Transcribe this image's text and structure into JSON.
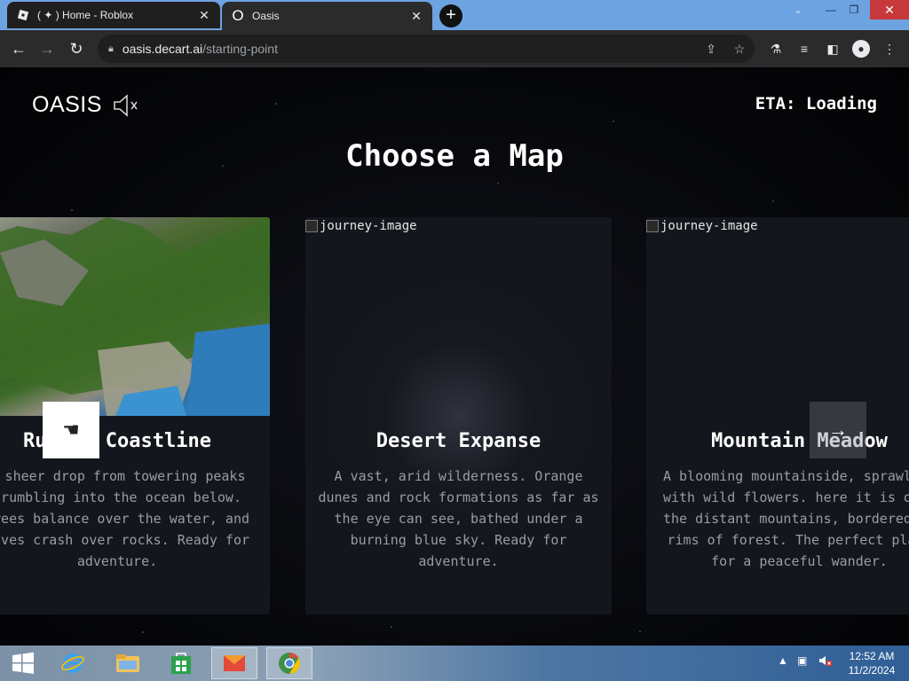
{
  "browser": {
    "tabs": [
      {
        "title": "( ✦ ) Home - Roblox",
        "favicon": "roblox-icon"
      },
      {
        "title": "Oasis",
        "favicon": "oasis-icon"
      }
    ],
    "new_tab_label": "+",
    "url_host": "oasis.decart.ai",
    "url_path": "/starting-point"
  },
  "page": {
    "logo": "OASIS",
    "eta": "ETA: Loading",
    "heading": "Choose a Map",
    "cards": [
      {
        "title": "Rugged Coastline",
        "description": "A sheer drop from towering peaks crumbling into the ocean below. Trees balance over the water, and waves crash over rocks. Ready for adventure.",
        "image_alt": ""
      },
      {
        "title": "Desert Expanse",
        "description": "A vast, arid wilderness. Orange dunes and rock formations as far as the eye can see, bathed under a burning blue sky. Ready for adventure.",
        "image_alt": "journey-image"
      },
      {
        "title": "Mountain Meadow",
        "description": "A blooming mountainside, sprawling with wild flowers. here it is only the distant mountains, bordered by rims of forest. The perfect place for a peaceful wander.",
        "image_alt": "journey-image"
      }
    ]
  },
  "taskbar": {
    "time": "12:52 AM",
    "date": "11/2/2024"
  }
}
